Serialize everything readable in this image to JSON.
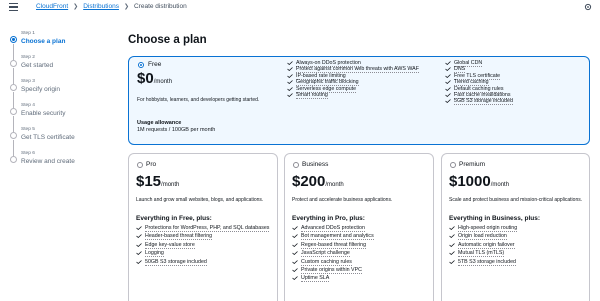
{
  "breadcrumb": {
    "items": [
      "CloudFront",
      "Distributions"
    ],
    "current": "Create distribution"
  },
  "steps": [
    {
      "num": "Step 1",
      "title": "Choose a plan"
    },
    {
      "num": "Step 2",
      "title": "Get started"
    },
    {
      "num": "Step 3",
      "title": "Specify origin"
    },
    {
      "num": "Step 4",
      "title": "Enable security"
    },
    {
      "num": "Step 5",
      "title": "Get TLS certificate"
    },
    {
      "num": "Step 6",
      "title": "Review and create"
    }
  ],
  "page_title": "Choose a plan",
  "free_plan": {
    "name": "Free",
    "price": "$0",
    "unit": "/month",
    "description": "For hobbyists, learners, and developers getting started.",
    "usage_title": "Usage allowance",
    "usage_value": "1M requests / 100GB per month",
    "features_col1": [
      "Always-on DDoS protection",
      "Protect against common web threats with AWS WAF",
      "IP-based rate limiting",
      "Geographic traffic blocking",
      "Serverless edge compute",
      "Smart routing"
    ],
    "features_col2": [
      "Global CDN",
      "DNS",
      "Free TLS certificate",
      "Tiered caching",
      "Default caching rules",
      "Fast cache invalidations",
      "5GB S3 storage included"
    ]
  },
  "plans": [
    {
      "name": "Pro",
      "price": "$15",
      "unit": "/month",
      "description": "Launch and grow small websites, blogs, and applications.",
      "everything": "Everything in Free, plus:",
      "features": [
        "Protections for WordPress, PHP, and SQL databases",
        "Header-based threat filtering",
        "Edge key-value store",
        "Logging",
        "50GB S3 storage included"
      ]
    },
    {
      "name": "Business",
      "price": "$200",
      "unit": "/month",
      "description": "Protect and accelerate business applications.",
      "everything": "Everything in Pro, plus:",
      "features": [
        "Advanced DDoS protection",
        "Bot management and analytics",
        "Regex-based threat filtering",
        "JavaScript challenge",
        "Custom caching rules",
        "Private origins within VPC",
        "Uptime SLA"
      ]
    },
    {
      "name": "Premium",
      "price": "$1000",
      "unit": "/month",
      "description": "Scale and protect business and mission-critical applications.",
      "everything": "Everything in Business, plus:",
      "features": [
        "High-speed origin routing",
        "Origin load reduction",
        "Automatic origin failover",
        "Mutual TLS (mTLS)",
        "5TB S3 storage included"
      ]
    }
  ],
  "colors": {
    "accent": "#0972d3",
    "selected_bg": "#f0f8ff",
    "text": "#0f141a",
    "muted": "#5f6b7a",
    "border": "#c6c6cd"
  }
}
